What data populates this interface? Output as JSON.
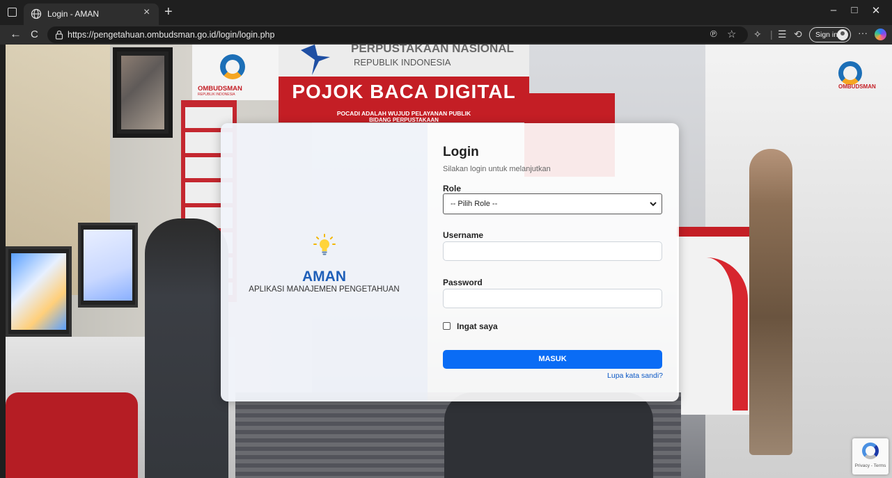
{
  "browser": {
    "tab_title": "Login - AMAN",
    "tab_close": "×",
    "new_tab": "+",
    "url": "https://pengetahuan.ombudsman.go.id/login/login.php",
    "signin_label": "Sign in",
    "more_label": "···",
    "window": {
      "minimize": "–",
      "maximize": "□",
      "close": "✕"
    },
    "nav": {
      "back": "←",
      "refresh": "C"
    }
  },
  "background_photo": {
    "sign_top_line1": "PERPUSTAKAAN NASIONAL",
    "sign_top_line2": "REPUBLIK INDONESIA",
    "sign_main": "POJOK BACA DIGITAL",
    "sign_sub": "POCADI ADALAH WUJUD PELAYANAN PUBLIK",
    "sign_sub2": "BIDANG PERPUSTAKAAN",
    "logo_text": "OMBUDSMAN",
    "logo_sub": "REPUBLIK INDONESIA",
    "logo_text_right": "OMBUDSMAN"
  },
  "brand": {
    "title": "AMAN",
    "subtitle": "APLIKASI MANAJEMEN PENGETAHUAN",
    "accent_color": "#1f5fb8",
    "icon": "lightbulb-icon"
  },
  "login": {
    "title": "Login",
    "subtitle": "Silakan login untuk melanjutkan",
    "role_label": "Role",
    "role_selected": "-- Pilih Role --",
    "username_label": "Username",
    "username_value": "",
    "password_label": "Password",
    "password_value": "",
    "remember_label": "Ingat saya",
    "remember_checked": false,
    "submit_label": "MASUK",
    "forgot_label": "Lupa kata sandi?",
    "button_color": "#0a6cf5"
  },
  "recaptcha": {
    "text": "Privacy - Terms"
  }
}
